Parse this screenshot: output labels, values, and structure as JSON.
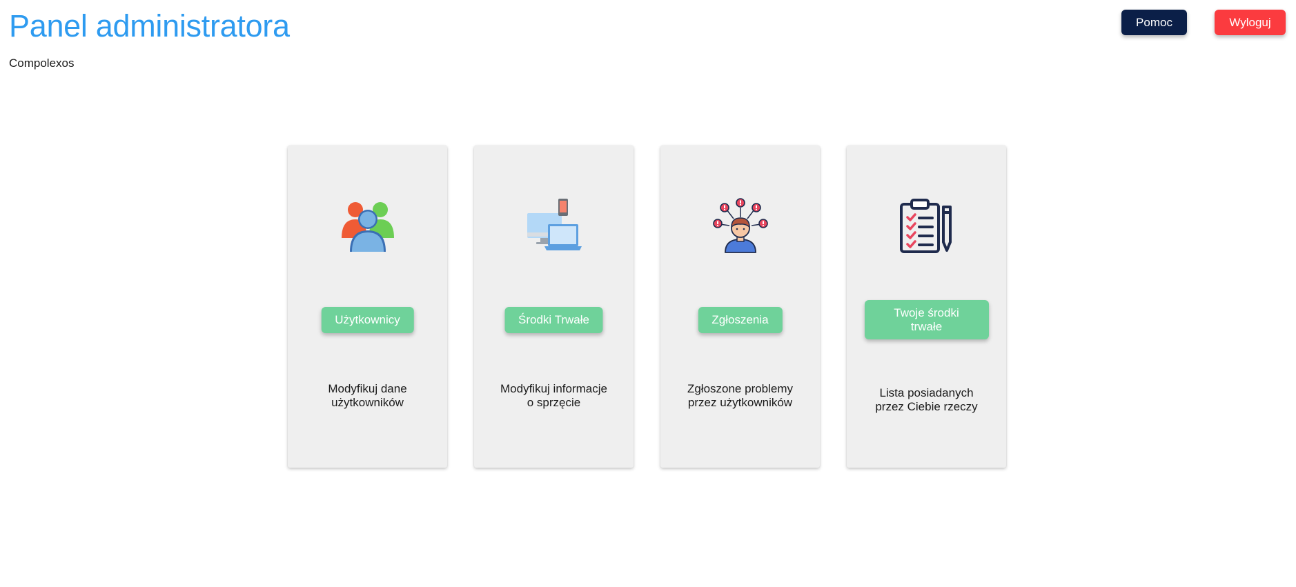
{
  "header": {
    "title": "Panel administratora",
    "subtitle": "Compolexos"
  },
  "top_buttons": {
    "help_label": "Pomoc",
    "logout_label": "Wyloguj"
  },
  "cards": [
    {
      "icon": "users-group-icon",
      "button_label": "Użytkownicy",
      "description": "Modyfikuj dane\nużytkowników"
    },
    {
      "icon": "devices-icon",
      "button_label": "Środki Trwałe",
      "description": "Modyfikuj informacje\no sprzęcie"
    },
    {
      "icon": "reported-problems-icon",
      "button_label": "Zgłoszenia",
      "description": "Zgłoszone problemy\nprzez użytkowników"
    },
    {
      "icon": "clipboard-checklist-icon",
      "button_label": "Twoje środki trwałe",
      "description": "Lista posiadanych\nprzez Ciebie rzeczy"
    }
  ],
  "colors": {
    "title": "#2e9bf0",
    "help_button": "#0b1f48",
    "logout_button": "#fb3b3f",
    "card_button": "#6fd29a",
    "card_background": "#efefef"
  }
}
